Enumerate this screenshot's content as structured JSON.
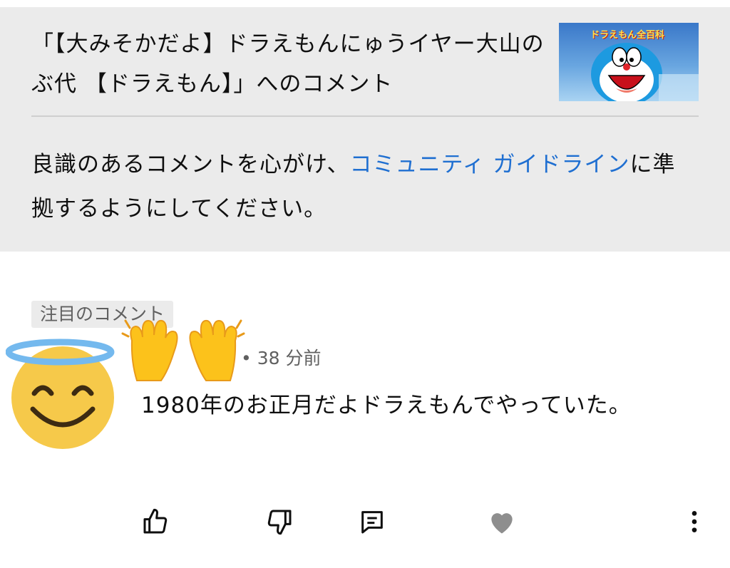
{
  "header": {
    "video_title": "「【大みそかだよ】ドラえもんにゅうイヤー大山のぶ代 【ドラえもん】」へのコメント",
    "thumbnail_title": "ドラえもん全百科",
    "guideline_before": "良識のあるコメントを心がけ、",
    "guideline_link": "コミュニティ ガイドライン",
    "guideline_after": "に準拠するようにしてください。"
  },
  "comment": {
    "pinned_label": "注目のコメント",
    "meta": "• 38 分前",
    "text": "1980年のお正月だよドラえもんでやっていた。",
    "avatar_icon": "smiling-face-with-halo-icon",
    "overlay_icon": "raising-hands-icon"
  },
  "actions": [
    {
      "name": "like-button",
      "icon": "thumbs-up-icon"
    },
    {
      "name": "dislike-button",
      "icon": "thumbs-down-icon"
    },
    {
      "name": "reply-button",
      "icon": "comment-icon"
    },
    {
      "name": "heart-button",
      "icon": "heart-icon"
    },
    {
      "name": "more-button",
      "icon": "more-vert-icon"
    }
  ],
  "colors": {
    "header_bg": "#ebebeb",
    "link": "#1f6fd1",
    "secondary_text": "#606060",
    "heart": "#8e8e8e"
  }
}
